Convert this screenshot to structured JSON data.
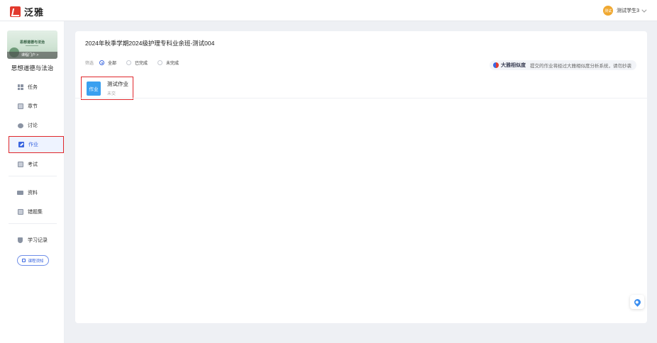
{
  "app": {
    "logo_text": "泛雅"
  },
  "user": {
    "avatar_text": "测试",
    "name": "测试学生3"
  },
  "course": {
    "cover_title": "思想道德与法治",
    "portal_label": "课程门户 >",
    "name": "思想道德与法治"
  },
  "sidebar": {
    "items": [
      {
        "label": "任务",
        "icon": "grid-icon"
      },
      {
        "label": "章节",
        "icon": "chapter-icon"
      },
      {
        "label": "讨论",
        "icon": "chat-icon"
      },
      {
        "label": "作业",
        "icon": "pencil-icon",
        "active": true
      },
      {
        "label": "考试",
        "icon": "exam-icon"
      },
      {
        "label": "资料",
        "icon": "folder-icon"
      },
      {
        "label": "错题集",
        "icon": "notebook-icon"
      },
      {
        "label": "学习记录",
        "icon": "shield-icon"
      }
    ],
    "notice_button": "课程须知"
  },
  "main": {
    "title": "2024年秋季学期2024级护理专科业余班-测试004",
    "filter": {
      "label": "筛选",
      "options": [
        "全部",
        "已完成",
        "未完成"
      ],
      "selected": "全部"
    },
    "similarity": {
      "brand": "大雅相似度",
      "notice": "提交的作业将经过大雅相似度分析系统，请勿抄袭"
    },
    "work_items": [
      {
        "icon_text": "作业",
        "title": "测试作业",
        "status": "未交"
      }
    ]
  },
  "colors": {
    "accent": "#3a66e0",
    "brand_red": "#e23a2e",
    "highlight_border": "#e0272b",
    "work_icon": "#3aa0f0"
  }
}
